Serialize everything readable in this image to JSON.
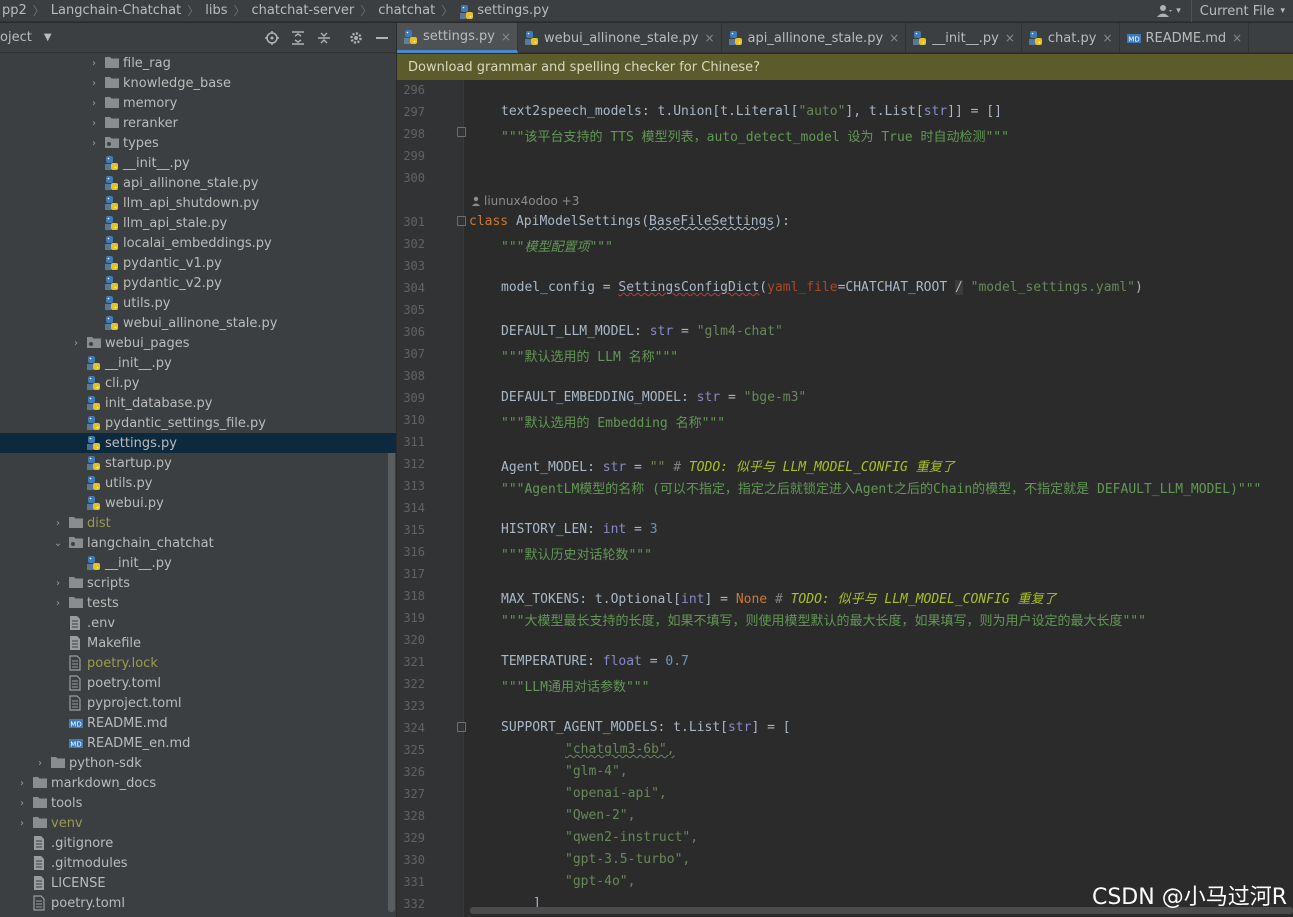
{
  "breadcrumbs": [
    "pp2",
    "Langchain-Chatchat",
    "libs",
    "chatchat-server",
    "chatchat",
    "settings.py"
  ],
  "topbar": {
    "current_file": "Current File",
    "user_icon": "user-icon"
  },
  "project_panel": {
    "title": "oject"
  },
  "tree": [
    {
      "indent": 5,
      "arrow": "›",
      "icon": "folder",
      "label": "file_rag"
    },
    {
      "indent": 5,
      "arrow": "›",
      "icon": "folder",
      "label": "knowledge_base"
    },
    {
      "indent": 5,
      "arrow": "›",
      "icon": "folder",
      "label": "memory"
    },
    {
      "indent": 5,
      "arrow": "›",
      "icon": "folder",
      "label": "reranker"
    },
    {
      "indent": 5,
      "arrow": "›",
      "icon": "pkg",
      "label": "types"
    },
    {
      "indent": 5,
      "arrow": "",
      "icon": "py",
      "label": "__init__.py"
    },
    {
      "indent": 5,
      "arrow": "",
      "icon": "py",
      "label": "api_allinone_stale.py"
    },
    {
      "indent": 5,
      "arrow": "",
      "icon": "py",
      "label": "llm_api_shutdown.py"
    },
    {
      "indent": 5,
      "arrow": "",
      "icon": "py",
      "label": "llm_api_stale.py"
    },
    {
      "indent": 5,
      "arrow": "",
      "icon": "py",
      "label": "localai_embeddings.py"
    },
    {
      "indent": 5,
      "arrow": "",
      "icon": "py",
      "label": "pydantic_v1.py"
    },
    {
      "indent": 5,
      "arrow": "",
      "icon": "py",
      "label": "pydantic_v2.py"
    },
    {
      "indent": 5,
      "arrow": "",
      "icon": "py",
      "label": "utils.py"
    },
    {
      "indent": 5,
      "arrow": "",
      "icon": "py",
      "label": "webui_allinone_stale.py"
    },
    {
      "indent": 4,
      "arrow": "›",
      "icon": "pkg",
      "label": "webui_pages"
    },
    {
      "indent": 4,
      "arrow": "",
      "icon": "py",
      "label": "__init__.py"
    },
    {
      "indent": 4,
      "arrow": "",
      "icon": "py",
      "label": "cli.py"
    },
    {
      "indent": 4,
      "arrow": "",
      "icon": "py",
      "label": "init_database.py"
    },
    {
      "indent": 4,
      "arrow": "",
      "icon": "py",
      "label": "pydantic_settings_file.py"
    },
    {
      "indent": 4,
      "arrow": "",
      "icon": "py",
      "label": "settings.py",
      "selected": true
    },
    {
      "indent": 4,
      "arrow": "",
      "icon": "py",
      "label": "startup.py"
    },
    {
      "indent": 4,
      "arrow": "",
      "icon": "py",
      "label": "utils.py"
    },
    {
      "indent": 4,
      "arrow": "",
      "icon": "py",
      "label": "webui.py"
    },
    {
      "indent": 3,
      "arrow": "›",
      "icon": "folder",
      "label": "dist",
      "style": "yellow"
    },
    {
      "indent": 3,
      "arrow": "⌄",
      "icon": "pkg",
      "label": "langchain_chatchat"
    },
    {
      "indent": 4,
      "arrow": "",
      "icon": "py",
      "label": "__init__.py"
    },
    {
      "indent": 3,
      "arrow": "›",
      "icon": "folder",
      "label": "scripts"
    },
    {
      "indent": 3,
      "arrow": "›",
      "icon": "folder",
      "label": "tests"
    },
    {
      "indent": 3,
      "arrow": "",
      "icon": "file",
      "label": ".env"
    },
    {
      "indent": 3,
      "arrow": "",
      "icon": "file",
      "label": "Makefile"
    },
    {
      "indent": 3,
      "arrow": "",
      "icon": "toml",
      "label": "poetry.lock",
      "style": "yellow"
    },
    {
      "indent": 3,
      "arrow": "",
      "icon": "toml",
      "label": "poetry.toml"
    },
    {
      "indent": 3,
      "arrow": "",
      "icon": "toml",
      "label": "pyproject.toml"
    },
    {
      "indent": 3,
      "arrow": "",
      "icon": "md",
      "label": "README.md"
    },
    {
      "indent": 3,
      "arrow": "",
      "icon": "md",
      "label": "README_en.md"
    },
    {
      "indent": 2,
      "arrow": "›",
      "icon": "folder",
      "label": "python-sdk"
    },
    {
      "indent": 1,
      "arrow": "›",
      "icon": "folder",
      "label": "markdown_docs"
    },
    {
      "indent": 1,
      "arrow": "›",
      "icon": "folder",
      "label": "tools"
    },
    {
      "indent": 1,
      "arrow": "›",
      "icon": "folder",
      "label": "venv",
      "style": "yellow"
    },
    {
      "indent": 1,
      "arrow": "",
      "icon": "file",
      "label": ".gitignore"
    },
    {
      "indent": 1,
      "arrow": "",
      "icon": "file",
      "label": ".gitmodules"
    },
    {
      "indent": 1,
      "arrow": "",
      "icon": "file",
      "label": "LICENSE"
    },
    {
      "indent": 1,
      "arrow": "",
      "icon": "toml",
      "label": "poetry.toml"
    }
  ],
  "tabs": [
    {
      "label": "settings.py",
      "icon": "py",
      "active": true
    },
    {
      "label": "webui_allinone_stale.py",
      "icon": "py"
    },
    {
      "label": "api_allinone_stale.py",
      "icon": "py"
    },
    {
      "label": "__init__.py",
      "icon": "py"
    },
    {
      "label": "chat.py",
      "icon": "py"
    },
    {
      "label": "README.md",
      "icon": "md"
    }
  ],
  "notification": "Download grammar and spelling checker for Chinese?",
  "author_hint": "liunux4odoo +3",
  "line_numbers": [
    "296",
    "297",
    "298",
    "299",
    "300",
    "301",
    "302",
    "303",
    "304",
    "305",
    "306",
    "307",
    "308",
    "309",
    "310",
    "311",
    "312",
    "313",
    "314",
    "315",
    "316",
    "317",
    "318",
    "319",
    "320",
    "321",
    "322",
    "323",
    "324",
    "325",
    "326",
    "327",
    "328",
    "329",
    "330",
    "331",
    "332"
  ],
  "code": {
    "l297": [
      "text2speech_models",
      ": t.Union[t.Literal[",
      "\"auto\"",
      "], t.List[",
      "str",
      "]] = []"
    ],
    "l298": "\"\"\"该平台支持的 TTS 模型列表，auto_detect_model 设为 True 时自动检测\"\"\"",
    "l301": [
      "class ",
      "ApiModelSettings",
      "(",
      "BaseFileSettings",
      "):"
    ],
    "l302": "\"\"\"模型配置项\"\"\"",
    "l304": [
      "model_config = ",
      "SettingsConfigDict",
      "(",
      "yaml_file",
      "=CHATCHAT_ROOT ",
      "/",
      " ",
      "\"model_settings.yaml\"",
      ")"
    ],
    "l306": [
      "DEFAULT_LLM_MODEL: ",
      "str",
      " = ",
      "\"glm4-chat\""
    ],
    "l307": "\"\"\"默认选用的 LLM 名称\"\"\"",
    "l309": [
      "DEFAULT_EMBEDDING_MODEL: ",
      "str",
      " = ",
      "\"bge-m3\""
    ],
    "l310": "\"\"\"默认选用的 Embedding 名称\"\"\"",
    "l312": [
      "Agent_MODEL: ",
      "str",
      " = ",
      "\"\"",
      " # ",
      "TODO: 似乎与 LLM_MODEL_CONFIG 重复了"
    ],
    "l313": "\"\"\"AgentLM模型的名称 (可以不指定，指定之后就锁定进入Agent之后的Chain的模型，不指定就是 DEFAULT_LLM_MODEL)\"\"\"",
    "l315": [
      "HISTORY_LEN: ",
      "int",
      " = ",
      "3"
    ],
    "l316": "\"\"\"默认历史对话轮数\"\"\"",
    "l318": [
      "MAX_TOKENS: t.Optional[",
      "int",
      "] = ",
      "None",
      " # ",
      "TODO: 似乎与 LLM_MODEL_CONFIG 重复了"
    ],
    "l319": "\"\"\"大模型最长支持的长度，如果不填写，则使用模型默认的最大长度，如果填写，则为用户设定的最大长度\"\"\"",
    "l321": [
      "TEMPERATURE: ",
      "float",
      " = ",
      "0.7"
    ],
    "l322": "\"\"\"LLM通用对话参数\"\"\"",
    "l324": [
      "SUPPORT_AGENT_MODELS: t.List[",
      "str",
      "] = ["
    ],
    "l325": "\"chatglm3-6b\",",
    "l326": "\"glm-4\",",
    "l327": "\"openai-api\",",
    "l328": "\"Qwen-2\",",
    "l329": "\"qwen2-instruct\",",
    "l330": "\"gpt-3.5-turbo\",",
    "l331": "\"gpt-4o\",",
    "l332": "]"
  },
  "watermark": "CSDN @小马过河R"
}
